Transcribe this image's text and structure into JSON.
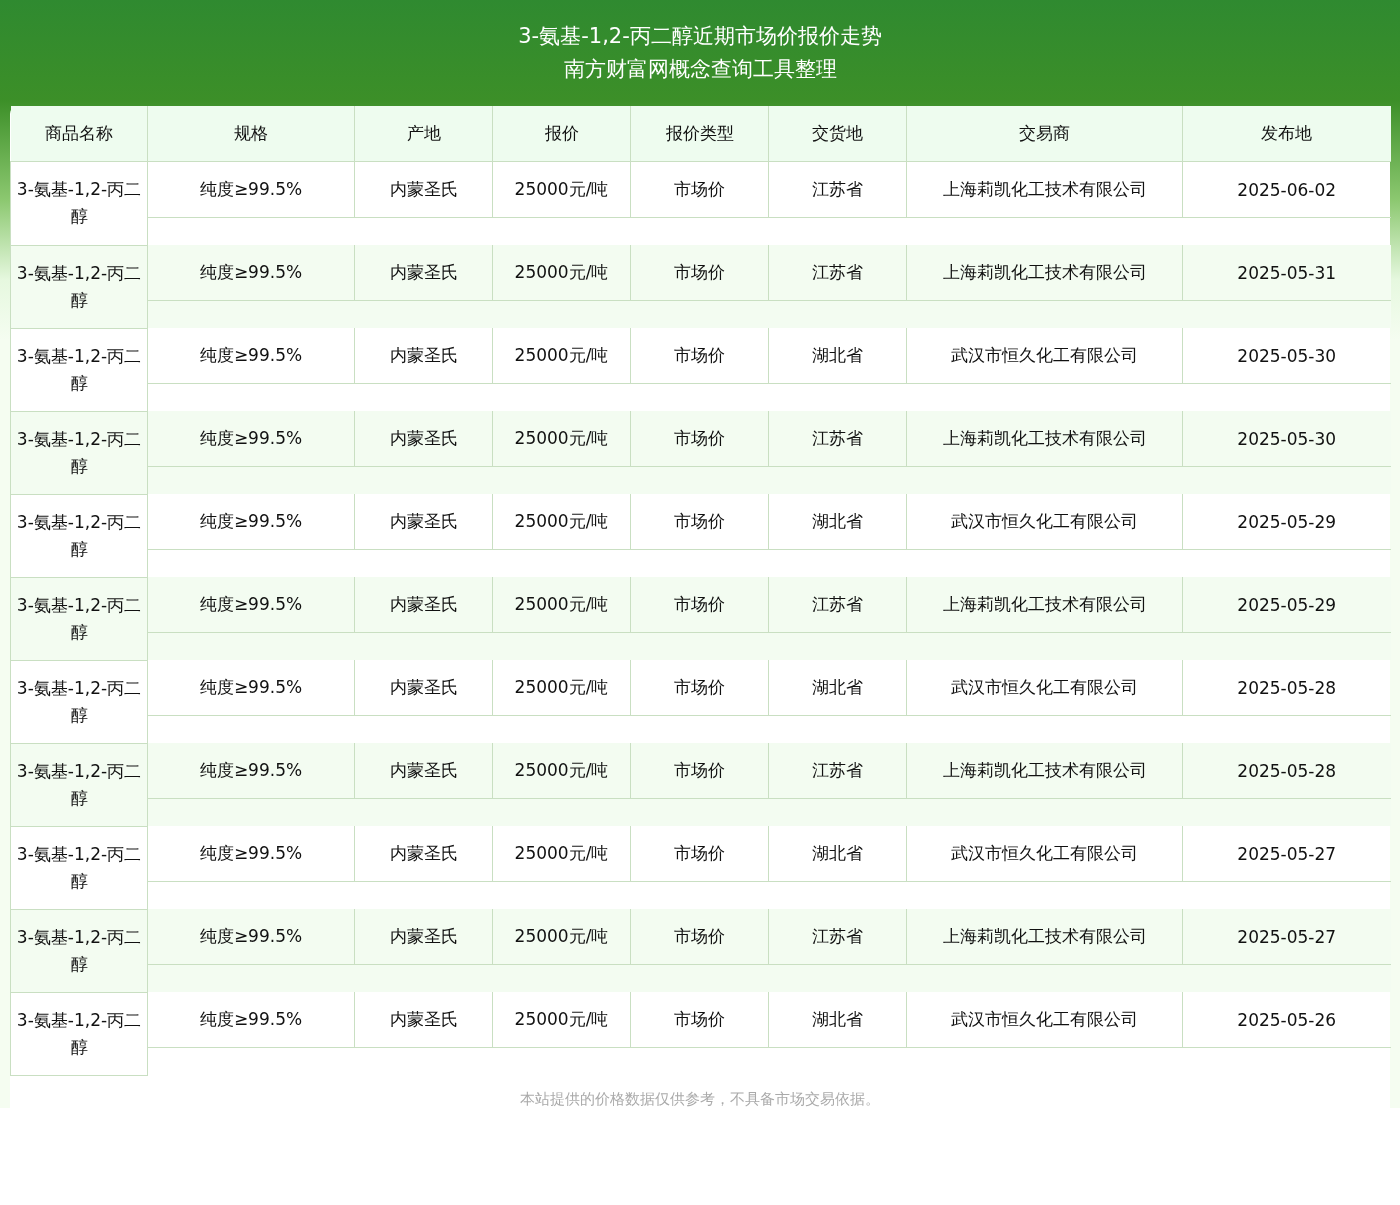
{
  "header": {
    "title": "3-氨基-1,2-丙二醇近期市场价报价走势",
    "subtitle": "南方财富网概念查询工具整理"
  },
  "table": {
    "columns": [
      "商品名称",
      "规格",
      "产地",
      "报价",
      "报价类型",
      "交货地",
      "交易商",
      "发布地"
    ],
    "rows": [
      [
        "3-氨基-1,2-丙二醇",
        "纯度≥99.5%",
        "内蒙圣氏",
        "25000元/吨",
        "市场价",
        "江苏省",
        "上海莉凯化工技术有限公司",
        "2025-06-02"
      ],
      [
        "3-氨基-1,2-丙二醇",
        "纯度≥99.5%",
        "内蒙圣氏",
        "25000元/吨",
        "市场价",
        "江苏省",
        "上海莉凯化工技术有限公司",
        "2025-05-31"
      ],
      [
        "3-氨基-1,2-丙二醇",
        "纯度≥99.5%",
        "内蒙圣氏",
        "25000元/吨",
        "市场价",
        "湖北省",
        "武汉市恒久化工有限公司",
        "2025-05-30"
      ],
      [
        "3-氨基-1,2-丙二醇",
        "纯度≥99.5%",
        "内蒙圣氏",
        "25000元/吨",
        "市场价",
        "江苏省",
        "上海莉凯化工技术有限公司",
        "2025-05-30"
      ],
      [
        "3-氨基-1,2-丙二醇",
        "纯度≥99.5%",
        "内蒙圣氏",
        "25000元/吨",
        "市场价",
        "湖北省",
        "武汉市恒久化工有限公司",
        "2025-05-29"
      ],
      [
        "3-氨基-1,2-丙二醇",
        "纯度≥99.5%",
        "内蒙圣氏",
        "25000元/吨",
        "市场价",
        "江苏省",
        "上海莉凯化工技术有限公司",
        "2025-05-29"
      ],
      [
        "3-氨基-1,2-丙二醇",
        "纯度≥99.5%",
        "内蒙圣氏",
        "25000元/吨",
        "市场价",
        "湖北省",
        "武汉市恒久化工有限公司",
        "2025-05-28"
      ],
      [
        "3-氨基-1,2-丙二醇",
        "纯度≥99.5%",
        "内蒙圣氏",
        "25000元/吨",
        "市场价",
        "江苏省",
        "上海莉凯化工技术有限公司",
        "2025-05-28"
      ],
      [
        "3-氨基-1,2-丙二醇",
        "纯度≥99.5%",
        "内蒙圣氏",
        "25000元/吨",
        "市场价",
        "湖北省",
        "武汉市恒久化工有限公司",
        "2025-05-27"
      ],
      [
        "3-氨基-1,2-丙二醇",
        "纯度≥99.5%",
        "内蒙圣氏",
        "25000元/吨",
        "市场价",
        "江苏省",
        "上海莉凯化工技术有限公司",
        "2025-05-27"
      ],
      [
        "3-氨基-1,2-丙二醇",
        "纯度≥99.5%",
        "内蒙圣氏",
        "25000元/吨",
        "市场价",
        "湖北省",
        "武汉市恒久化工有限公司",
        "2025-05-26"
      ]
    ]
  },
  "footer_note": "本站提供的价格数据仅供参考，不具备市场交易依据。"
}
